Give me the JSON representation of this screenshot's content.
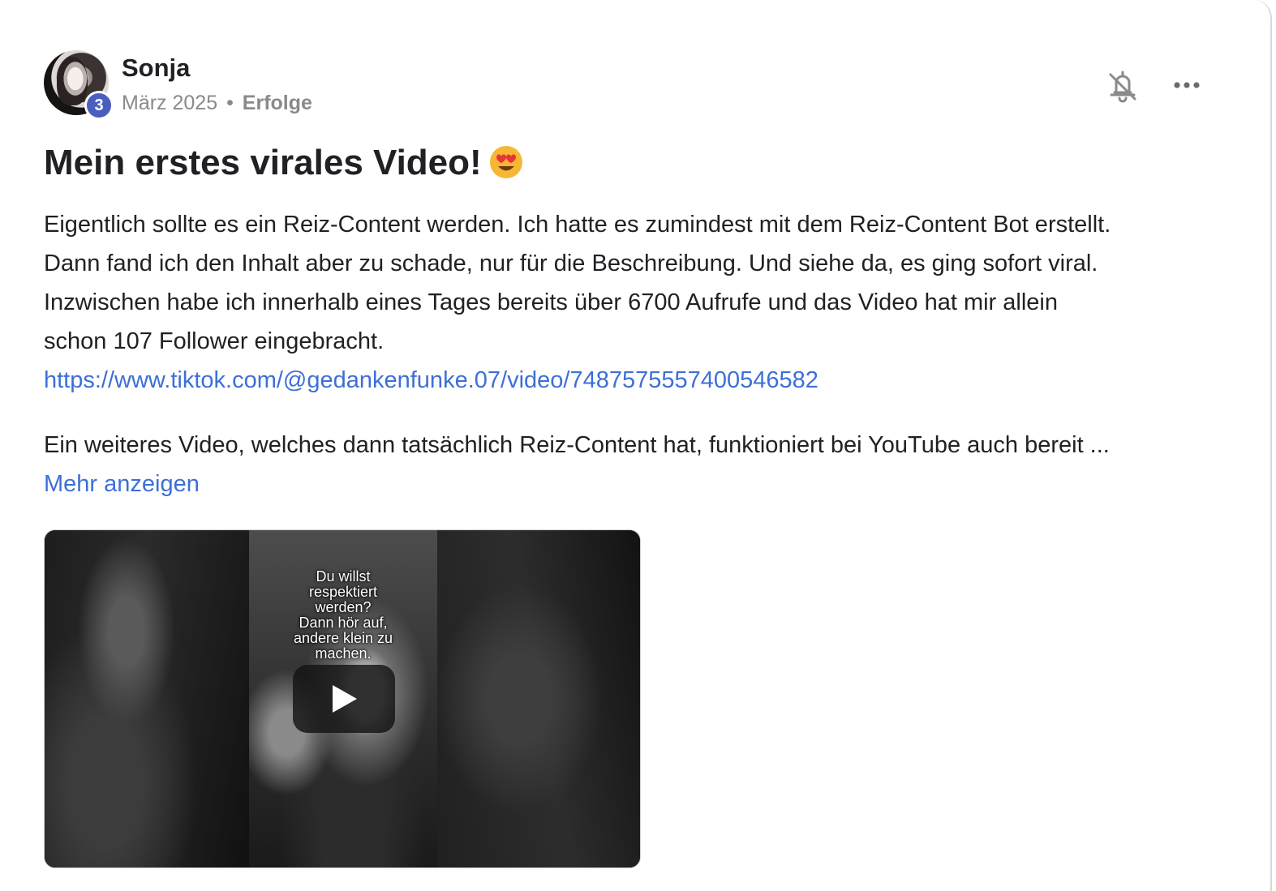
{
  "author": {
    "name": "Sonja",
    "level": "3",
    "date": "März 2025",
    "separator": "•",
    "category": "Erfolge"
  },
  "icons": {
    "notifications": "bell-off-icon",
    "more": "more-horizontal-icon",
    "emoji": "heart-eyes-emoji",
    "play": "play-icon"
  },
  "post": {
    "title": "Mein erstes virales Video!",
    "lines": [
      "Eigentlich sollte es ein Reiz-Content werden. Ich hatte es zumindest mit dem Reiz-Content Bot erstellt.",
      "Dann fand ich den Inhalt aber zu schade, nur für die Beschreibung. Und siehe da, es ging sofort viral.",
      "Inzwischen habe ich innerhalb eines Tages bereits über 6700 Aufrufe und das Video hat mir allein",
      "schon 107 Follower eingebracht."
    ],
    "link": "https://www.tiktok.com/@gedankenfunke.07/video/7487575557400546582",
    "paragraph2": "Ein weiteres Video, welches dann tatsächlich Reiz-Content hat, funktioniert bei YouTube auch bereit ...",
    "show_more": "Mehr anzeigen"
  },
  "video": {
    "caption_lines": [
      "Du willst",
      "respektiert",
      "werden?",
      "Dann hör auf,",
      "andere klein zu",
      "machen."
    ]
  },
  "colors": {
    "link": "#3d6fd6",
    "badge": "#4a5fbd",
    "text": "#202124",
    "muted": "#8a8a8a"
  }
}
